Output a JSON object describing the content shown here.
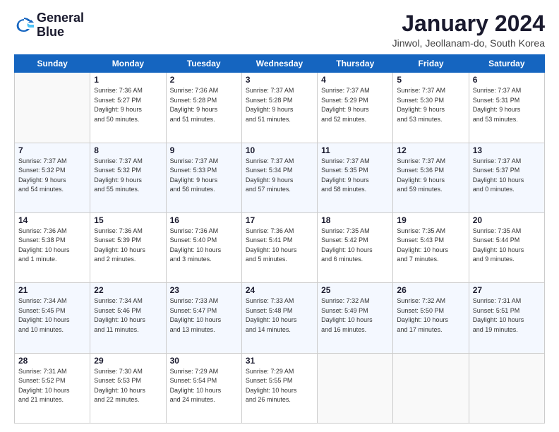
{
  "header": {
    "logo_line1": "General",
    "logo_line2": "Blue",
    "month_title": "January 2024",
    "subtitle": "Jinwol, Jeollanam-do, South Korea"
  },
  "weekdays": [
    "Sunday",
    "Monday",
    "Tuesday",
    "Wednesday",
    "Thursday",
    "Friday",
    "Saturday"
  ],
  "weeks": [
    [
      {
        "day": "",
        "info": ""
      },
      {
        "day": "1",
        "info": "Sunrise: 7:36 AM\nSunset: 5:27 PM\nDaylight: 9 hours\nand 50 minutes."
      },
      {
        "day": "2",
        "info": "Sunrise: 7:36 AM\nSunset: 5:28 PM\nDaylight: 9 hours\nand 51 minutes."
      },
      {
        "day": "3",
        "info": "Sunrise: 7:37 AM\nSunset: 5:28 PM\nDaylight: 9 hours\nand 51 minutes."
      },
      {
        "day": "4",
        "info": "Sunrise: 7:37 AM\nSunset: 5:29 PM\nDaylight: 9 hours\nand 52 minutes."
      },
      {
        "day": "5",
        "info": "Sunrise: 7:37 AM\nSunset: 5:30 PM\nDaylight: 9 hours\nand 53 minutes."
      },
      {
        "day": "6",
        "info": "Sunrise: 7:37 AM\nSunset: 5:31 PM\nDaylight: 9 hours\nand 53 minutes."
      }
    ],
    [
      {
        "day": "7",
        "info": "Sunrise: 7:37 AM\nSunset: 5:32 PM\nDaylight: 9 hours\nand 54 minutes."
      },
      {
        "day": "8",
        "info": "Sunrise: 7:37 AM\nSunset: 5:32 PM\nDaylight: 9 hours\nand 55 minutes."
      },
      {
        "day": "9",
        "info": "Sunrise: 7:37 AM\nSunset: 5:33 PM\nDaylight: 9 hours\nand 56 minutes."
      },
      {
        "day": "10",
        "info": "Sunrise: 7:37 AM\nSunset: 5:34 PM\nDaylight: 9 hours\nand 57 minutes."
      },
      {
        "day": "11",
        "info": "Sunrise: 7:37 AM\nSunset: 5:35 PM\nDaylight: 9 hours\nand 58 minutes."
      },
      {
        "day": "12",
        "info": "Sunrise: 7:37 AM\nSunset: 5:36 PM\nDaylight: 9 hours\nand 59 minutes."
      },
      {
        "day": "13",
        "info": "Sunrise: 7:37 AM\nSunset: 5:37 PM\nDaylight: 10 hours\nand 0 minutes."
      }
    ],
    [
      {
        "day": "14",
        "info": "Sunrise: 7:36 AM\nSunset: 5:38 PM\nDaylight: 10 hours\nand 1 minute."
      },
      {
        "day": "15",
        "info": "Sunrise: 7:36 AM\nSunset: 5:39 PM\nDaylight: 10 hours\nand 2 minutes."
      },
      {
        "day": "16",
        "info": "Sunrise: 7:36 AM\nSunset: 5:40 PM\nDaylight: 10 hours\nand 3 minutes."
      },
      {
        "day": "17",
        "info": "Sunrise: 7:36 AM\nSunset: 5:41 PM\nDaylight: 10 hours\nand 5 minutes."
      },
      {
        "day": "18",
        "info": "Sunrise: 7:35 AM\nSunset: 5:42 PM\nDaylight: 10 hours\nand 6 minutes."
      },
      {
        "day": "19",
        "info": "Sunrise: 7:35 AM\nSunset: 5:43 PM\nDaylight: 10 hours\nand 7 minutes."
      },
      {
        "day": "20",
        "info": "Sunrise: 7:35 AM\nSunset: 5:44 PM\nDaylight: 10 hours\nand 9 minutes."
      }
    ],
    [
      {
        "day": "21",
        "info": "Sunrise: 7:34 AM\nSunset: 5:45 PM\nDaylight: 10 hours\nand 10 minutes."
      },
      {
        "day": "22",
        "info": "Sunrise: 7:34 AM\nSunset: 5:46 PM\nDaylight: 10 hours\nand 11 minutes."
      },
      {
        "day": "23",
        "info": "Sunrise: 7:33 AM\nSunset: 5:47 PM\nDaylight: 10 hours\nand 13 minutes."
      },
      {
        "day": "24",
        "info": "Sunrise: 7:33 AM\nSunset: 5:48 PM\nDaylight: 10 hours\nand 14 minutes."
      },
      {
        "day": "25",
        "info": "Sunrise: 7:32 AM\nSunset: 5:49 PM\nDaylight: 10 hours\nand 16 minutes."
      },
      {
        "day": "26",
        "info": "Sunrise: 7:32 AM\nSunset: 5:50 PM\nDaylight: 10 hours\nand 17 minutes."
      },
      {
        "day": "27",
        "info": "Sunrise: 7:31 AM\nSunset: 5:51 PM\nDaylight: 10 hours\nand 19 minutes."
      }
    ],
    [
      {
        "day": "28",
        "info": "Sunrise: 7:31 AM\nSunset: 5:52 PM\nDaylight: 10 hours\nand 21 minutes."
      },
      {
        "day": "29",
        "info": "Sunrise: 7:30 AM\nSunset: 5:53 PM\nDaylight: 10 hours\nand 22 minutes."
      },
      {
        "day": "30",
        "info": "Sunrise: 7:29 AM\nSunset: 5:54 PM\nDaylight: 10 hours\nand 24 minutes."
      },
      {
        "day": "31",
        "info": "Sunrise: 7:29 AM\nSunset: 5:55 PM\nDaylight: 10 hours\nand 26 minutes."
      },
      {
        "day": "",
        "info": ""
      },
      {
        "day": "",
        "info": ""
      },
      {
        "day": "",
        "info": ""
      }
    ]
  ]
}
